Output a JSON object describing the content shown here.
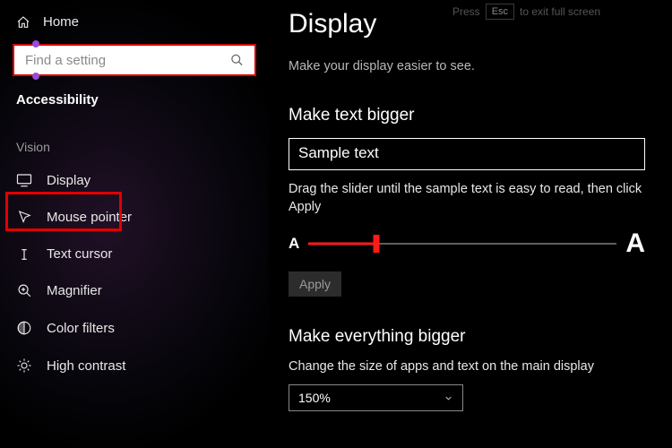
{
  "fullscreen_hint": {
    "press": "Press",
    "key": "Esc",
    "rest": "to exit full screen"
  },
  "sidebar": {
    "home": "Home",
    "search_placeholder": "Find a setting",
    "section": "Accessibility",
    "group": "Vision",
    "items": [
      {
        "label": "Display"
      },
      {
        "label": "Mouse pointer"
      },
      {
        "label": "Text cursor"
      },
      {
        "label": "Magnifier"
      },
      {
        "label": "Color filters"
      },
      {
        "label": "High contrast"
      }
    ]
  },
  "main": {
    "title": "Display",
    "subtitle": "Make your display easier to see.",
    "text_bigger": {
      "heading": "Make text bigger",
      "sample": "Sample text",
      "instruction": "Drag the slider until the sample text is easy to read, then click Apply",
      "small_a": "A",
      "big_a": "A",
      "apply": "Apply"
    },
    "everything_bigger": {
      "heading": "Make everything bigger",
      "desc": "Change the size of apps and text on the main display",
      "value": "150%"
    }
  }
}
